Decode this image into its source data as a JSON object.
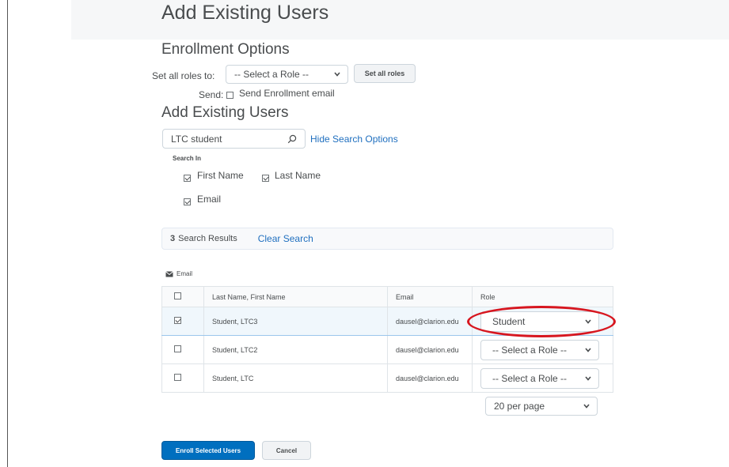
{
  "page": {
    "title": "Add Existing Users"
  },
  "enrollment": {
    "heading": "Enrollment Options",
    "set_all_label": "Set all roles to:",
    "role_select_value": "-- Select a Role --",
    "set_all_button": "Set all roles",
    "send_label": "Send:",
    "send_email_label": "Send Enrollment email"
  },
  "search": {
    "heading": "Add Existing Users",
    "value": "LTC student",
    "hide_options_link": "Hide Search Options",
    "search_in_label": "Search In",
    "fields": [
      {
        "label": "First Name",
        "checked": true
      },
      {
        "label": "Last Name",
        "checked": true
      },
      {
        "label": "Email",
        "checked": true
      }
    ]
  },
  "results": {
    "count": "3",
    "label": "Search Results",
    "clear_link": "Clear Search",
    "email_action": "Email"
  },
  "table": {
    "headers": [
      "Last Name, First Name",
      "Email",
      "Role"
    ],
    "rows": [
      {
        "name": "Student, LTC3",
        "email": "dausel@clarion.edu",
        "role": "Student",
        "checked": true
      },
      {
        "name": "Student, LTC2",
        "email": "dausel@clarion.edu",
        "role": "-- Select a Role --",
        "checked": false
      },
      {
        "name": "Student, LTC",
        "email": "dausel@clarion.edu",
        "role": "-- Select a Role --",
        "checked": false
      }
    ]
  },
  "pagination": {
    "per_page": "20 per page"
  },
  "actions": {
    "enroll_button": "Enroll Selected Users",
    "cancel_button": "Cancel"
  },
  "colors": {
    "primary": "#006fbf",
    "link": "#1f6fbf",
    "highlight_ellipse": "#d7161f"
  }
}
